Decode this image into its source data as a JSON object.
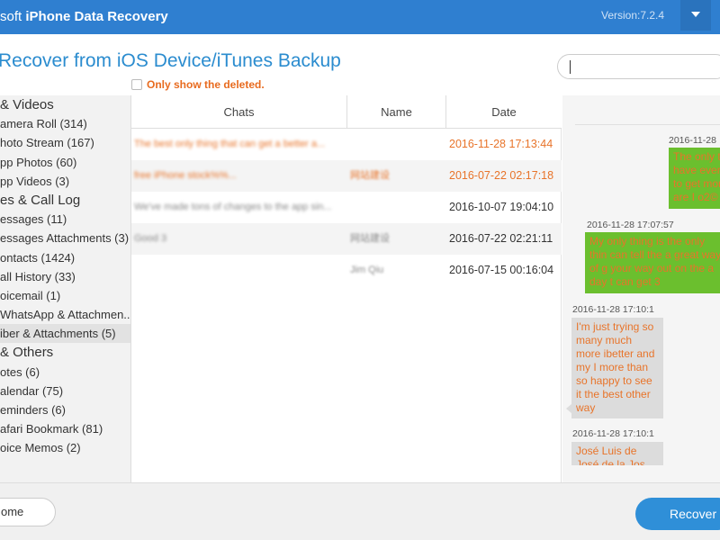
{
  "window": {
    "title_prefix": "soft",
    "title_main": "iPhone Data Recovery",
    "version": "Version:7.2.4"
  },
  "header": {
    "title": "Recover from iOS Device/iTunes Backup",
    "only_deleted_label": "Only show the deleted.",
    "search_value": ""
  },
  "sidebar": {
    "items": [
      {
        "label": "& Videos",
        "kind": "category"
      },
      {
        "label": "amera Roll (314)",
        "kind": "item"
      },
      {
        "label": "hoto Stream (167)",
        "kind": "item"
      },
      {
        "label": "pp Photos (60)",
        "kind": "item"
      },
      {
        "label": "pp Videos (3)",
        "kind": "item"
      },
      {
        "label": "es & Call Log",
        "kind": "category"
      },
      {
        "label": "essages (11)",
        "kind": "item"
      },
      {
        "label": "essages Attachments (3)",
        "kind": "item"
      },
      {
        "label": "ontacts (1424)",
        "kind": "item"
      },
      {
        "label": "all History (33)",
        "kind": "item"
      },
      {
        "label": "oicemail (1)",
        "kind": "item"
      },
      {
        "label": "WhatsApp & Attachmen...",
        "kind": "item"
      },
      {
        "label": "iber & Attachments (5)",
        "kind": "item",
        "active": true
      },
      {
        "label": "& Others",
        "kind": "category"
      },
      {
        "label": "otes (6)",
        "kind": "item"
      },
      {
        "label": "alendar (75)",
        "kind": "item"
      },
      {
        "label": "eminders (6)",
        "kind": "item"
      },
      {
        "label": "afari Bookmark (81)",
        "kind": "item"
      },
      {
        "label": "oice Memos (2)",
        "kind": "item"
      }
    ]
  },
  "table": {
    "columns": [
      "Chats",
      "Name",
      "Date"
    ],
    "rows": [
      {
        "chat": "The best only thing that can get a better a...",
        "name": "",
        "date": "2016-11-28 17:13:44",
        "deleted": true
      },
      {
        "chat": "free iPhone stock%%...",
        "name": "网站建设",
        "date": "2016-07-22 02:17:18",
        "deleted": true
      },
      {
        "chat": "We've made tons of changes to the app sin...",
        "name": "",
        "date": "2016-10-07 19:04:10",
        "deleted": false
      },
      {
        "chat": "Good 3",
        "name": "网站建设",
        "date": "2016-07-22 02:21:11",
        "deleted": false
      },
      {
        "chat": "",
        "name": "Jim Qiu",
        "date": "2016-07-15 00:16:04",
        "deleted": false
      }
    ]
  },
  "preview": {
    "messages": [
      {
        "time": "2016-11-28",
        "text": "The only t have ever to get mor are I o2©",
        "dir": "out"
      },
      {
        "time": "2016-11-28 17:07:57",
        "text": "My only thing is the only thin can tell the a great way of g your way out on the a day t can get 3",
        "dir": "out"
      },
      {
        "time": "2016-11-28 17:10:1",
        "text": "I'm just trying so many much more ibetter and my I more than so happy to see it the best other way",
        "dir": "in"
      },
      {
        "time": "2016-11-28 17:10:1",
        "text": "José Luis de José de la Jos",
        "dir": "in"
      }
    ]
  },
  "footer": {
    "home_label": "ome",
    "recover_label": "Recover"
  },
  "colors": {
    "accent": "#2f7fd0",
    "deleted_text": "#e8742a",
    "outgoing_bubble": "#6bbf2e",
    "incoming_bubble": "#dcdcdc"
  }
}
